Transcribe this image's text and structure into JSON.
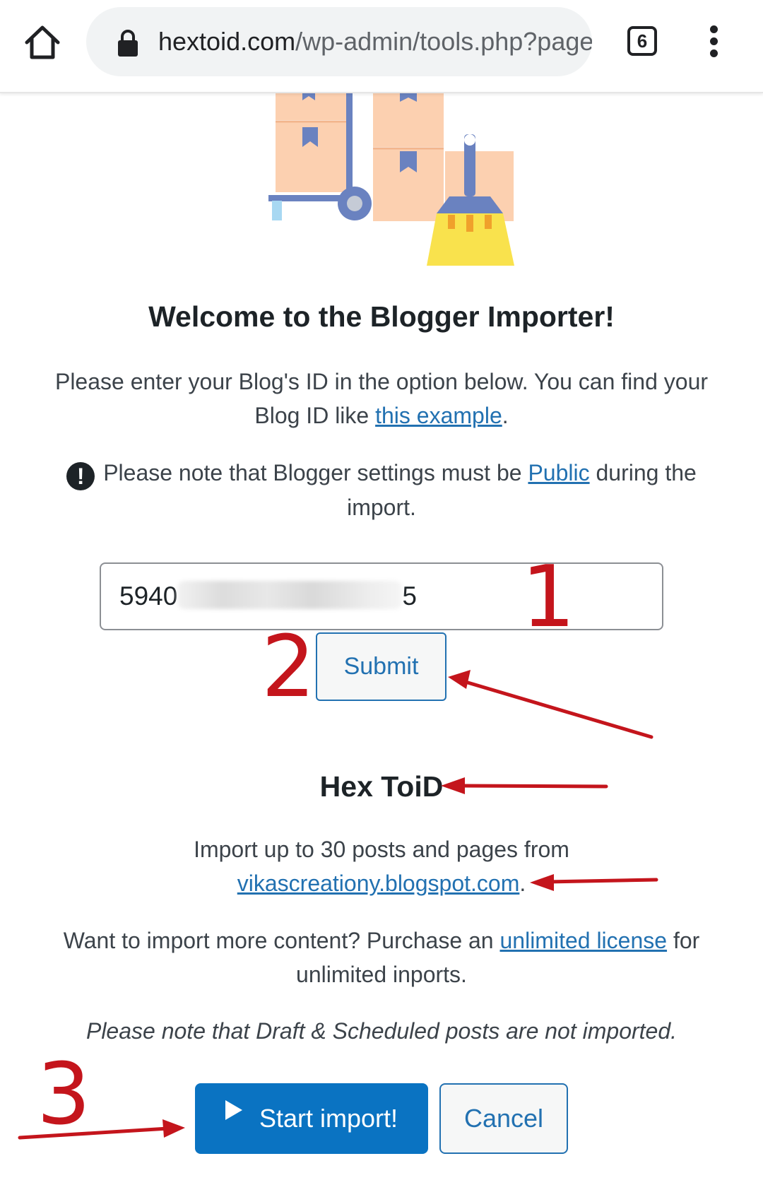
{
  "browser": {
    "url_host": "hextoid.com",
    "url_path": "/wp-admin/tools.php?page",
    "tab_count": "6",
    "icons": [
      "home-icon",
      "lock-icon",
      "tabs-counter-icon",
      "more-vert-icon"
    ]
  },
  "importer": {
    "heading": "Welcome to the Blogger Importer!",
    "intro_text": "Please enter your Blog's ID in the option below. You can find your Blog ID like",
    "intro_link": "this example",
    "intro_end": ".",
    "note_prefix": "Please note that Blogger settings must be",
    "note_link": "Public",
    "note_suffix": "during the import.",
    "note_icon": "exclamation-circle-icon",
    "blog_id_start": "5940",
    "blog_id_end": "5",
    "submit_label": "Submit",
    "site_name": "Hex ToiD",
    "import_text": "Import up to 30 posts and pages from",
    "import_link": "vikascreationy.blogspot.com",
    "import_end": ".",
    "upsell_text": "Want to import more content? Purchase an",
    "upsell_link": "unlimited license",
    "upsell_suffix": "for unlimited inports.",
    "draft_note": "Please note that Draft & Scheduled posts are not imported.",
    "start_label": "Start import!",
    "start_icon": "play-icon",
    "cancel_label": "Cancel"
  },
  "annotations": {
    "step_1": "1",
    "step_2": "2",
    "step_3": "3",
    "color": "#c4151c"
  }
}
